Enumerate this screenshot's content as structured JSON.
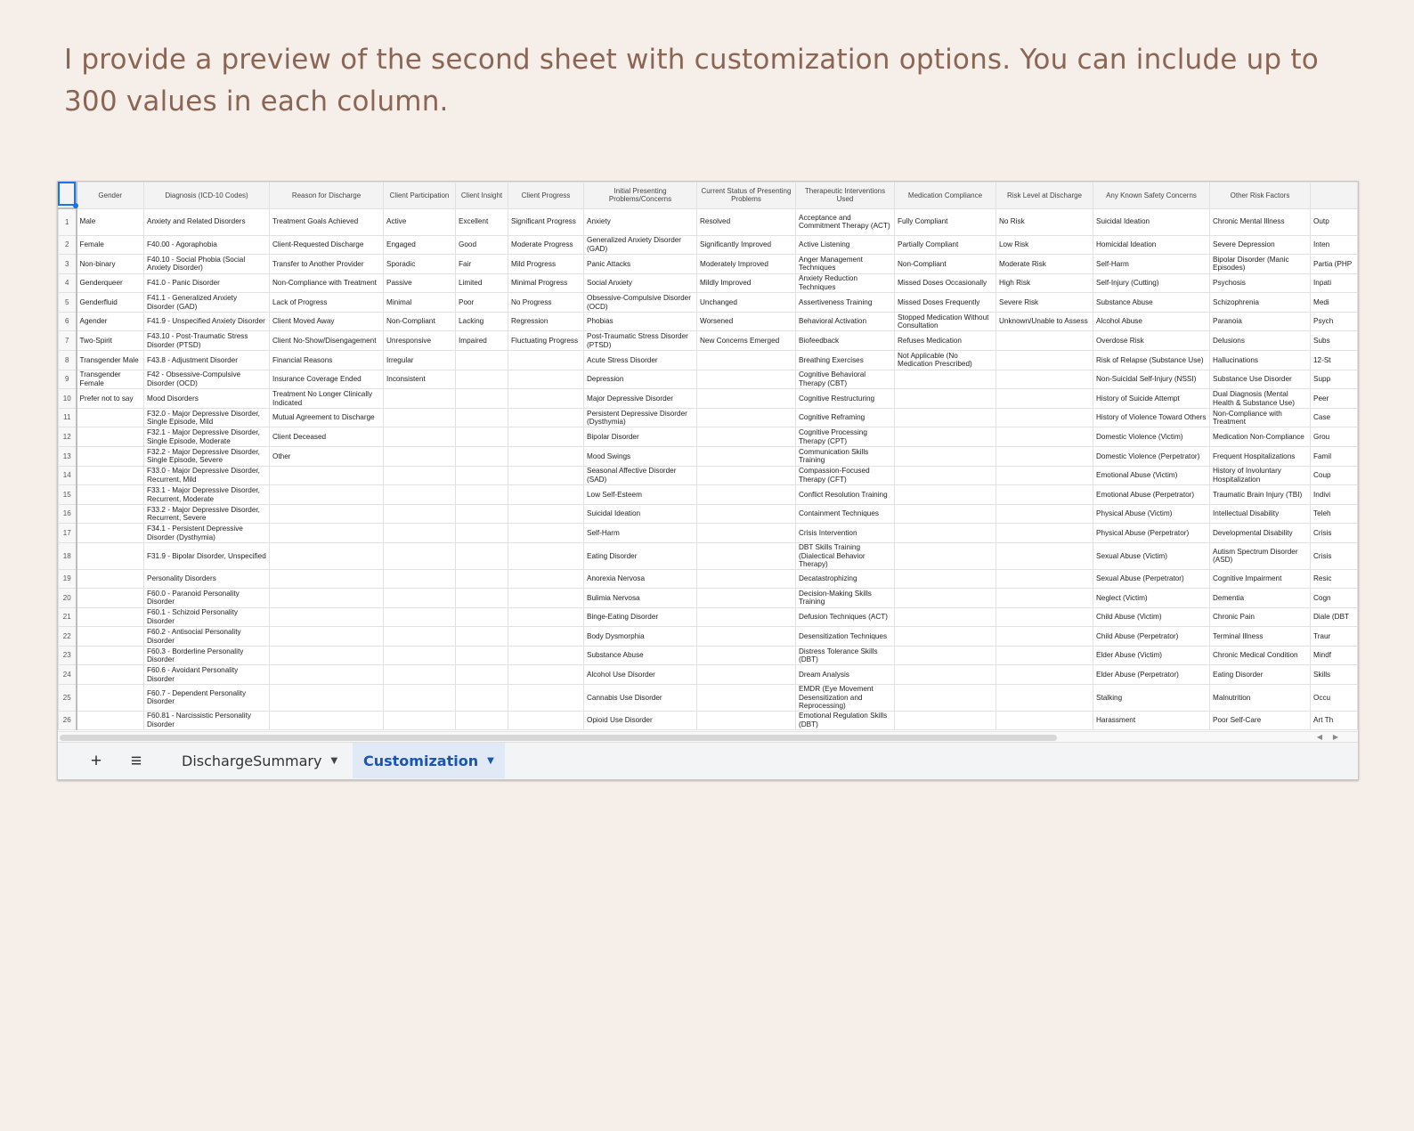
{
  "intro_text": "I provide a preview of the second sheet with customization options. You can include up to 300 values in each column.",
  "columns": [
    "Gender",
    "Diagnosis (ICD-10 Codes)",
    "Reason for Discharge",
    "Client Participation",
    "Client Insight",
    "Client Progress",
    "Initial Presenting Problems/Concerns",
    "Current Status of Presenting Problems",
    "Therapeutic Interventions Used",
    "Medication Compliance",
    "Risk Level at Discharge",
    "Any Known Safety Concerns",
    "Other Risk Factors",
    ""
  ],
  "rows": [
    [
      "1",
      "Male",
      "Anxiety and Related Disorders",
      "Treatment Goals Achieved",
      "Active",
      "Excellent",
      "Significant Progress",
      "Anxiety",
      "Resolved",
      "Acceptance and Commitment Therapy (ACT)",
      "Fully Compliant",
      "No Risk",
      "Suicidal Ideation",
      "Chronic Mental Illness",
      "Outp"
    ],
    [
      "2",
      "Female",
      "F40.00 - Agoraphobia",
      "Client-Requested Discharge",
      "Engaged",
      "Good",
      "Moderate Progress",
      "Generalized Anxiety Disorder (GAD)",
      "Significantly Improved",
      "Active Listening",
      "Partially Compliant",
      "Low Risk",
      "Homicidal Ideation",
      "Severe Depression",
      "Inten"
    ],
    [
      "3",
      "Non-binary",
      "F40.10 - Social Phobia (Social Anxiety Disorder)",
      "Transfer to Another Provider",
      "Sporadic",
      "Fair",
      "Mild Progress",
      "Panic Attacks",
      "Moderately Improved",
      "Anger Management Techniques",
      "Non-Compliant",
      "Moderate Risk",
      "Self-Harm",
      "Bipolar Disorder (Manic Episodes)",
      "Partia (PHP"
    ],
    [
      "4",
      "Genderqueer",
      "F41.0 - Panic Disorder",
      "Non-Compliance with Treatment",
      "Passive",
      "Limited",
      "Minimal Progress",
      "Social Anxiety",
      "Mildly Improved",
      "Anxiety Reduction Techniques",
      "Missed Doses Occasionally",
      "High Risk",
      "Self-Injury (Cutting)",
      "Psychosis",
      "Inpati"
    ],
    [
      "5",
      "Genderfluid",
      "F41.1 - Generalized Anxiety Disorder (GAD)",
      "Lack of Progress",
      "Minimal",
      "Poor",
      "No Progress",
      "Obsessive-Compulsive Disorder (OCD)",
      "Unchanged",
      "Assertiveness Training",
      "Missed Doses Frequently",
      "Severe Risk",
      "Substance Abuse",
      "Schizophrenia",
      "Medi"
    ],
    [
      "6",
      "Agender",
      "F41.9 - Unspecified Anxiety Disorder",
      "Client Moved Away",
      "Non-Compliant",
      "Lacking",
      "Regression",
      "Phobias",
      "Worsened",
      "Behavioral Activation",
      "Stopped Medication Without Consultation",
      "Unknown/Unable to Assess",
      "Alcohol Abuse",
      "Paranoia",
      "Psych"
    ],
    [
      "7",
      "Two-Spirit",
      "F43.10 - Post-Traumatic Stress Disorder (PTSD)",
      "Client No-Show/Disengagement",
      "Unresponsive",
      "Impaired",
      "Fluctuating Progress",
      "Post-Traumatic Stress Disorder (PTSD)",
      "New Concerns Emerged",
      "Biofeedback",
      "Refuses Medication",
      "",
      "Overdose Risk",
      "Delusions",
      "Subs"
    ],
    [
      "8",
      "Transgender Male",
      "F43.8 - Adjustment Disorder",
      "Financial Reasons",
      "Irregular",
      "",
      "",
      "Acute Stress Disorder",
      "",
      "Breathing Exercises",
      "Not Applicable (No Medication Prescribed)",
      "",
      "Risk of Relapse (Substance Use)",
      "Hallucinations",
      "12-St"
    ],
    [
      "9",
      "Transgender Female",
      "F42 - Obsessive-Compulsive Disorder (OCD)",
      "Insurance Coverage Ended",
      "Inconsistent",
      "",
      "",
      "Depression",
      "",
      "Cognitive Behavioral Therapy (CBT)",
      "",
      "",
      "Non-Suicidal Self-Injury (NSSI)",
      "Substance Use Disorder",
      "Supp"
    ],
    [
      "10",
      "Prefer not to say",
      "Mood Disorders",
      "Treatment No Longer Clinically Indicated",
      "",
      "",
      "",
      "Major Depressive Disorder",
      "",
      "Cognitive Restructuring",
      "",
      "",
      "History of Suicide Attempt",
      "Dual Diagnosis (Mental Health & Substance Use)",
      "Peer"
    ],
    [
      "11",
      "",
      "F32.0 - Major Depressive Disorder, Single Episode, Mild",
      "Mutual Agreement to Discharge",
      "",
      "",
      "",
      "Persistent Depressive Disorder (Dysthymia)",
      "",
      "Cognitive Reframing",
      "",
      "",
      "History of Violence Toward Others",
      "Non-Compliance with Treatment",
      "Case"
    ],
    [
      "12",
      "",
      "F32.1 - Major Depressive Disorder, Single Episode, Moderate",
      "Client Deceased",
      "",
      "",
      "",
      "Bipolar Disorder",
      "",
      "Cognitive Processing Therapy (CPT)",
      "",
      "",
      "Domestic Violence (Victim)",
      "Medication Non-Compliance",
      "Grou"
    ],
    [
      "13",
      "",
      "F32.2 - Major Depressive Disorder, Single Episode, Severe",
      "Other",
      "",
      "",
      "",
      "Mood Swings",
      "",
      "Communication Skills Training",
      "",
      "",
      "Domestic Violence (Perpetrator)",
      "Frequent Hospitalizations",
      "Famil"
    ],
    [
      "14",
      "",
      "F33.0 - Major Depressive Disorder, Recurrent, Mild",
      "",
      "",
      "",
      "",
      "Seasonal Affective Disorder (SAD)",
      "",
      "Compassion-Focused Therapy (CFT)",
      "",
      "",
      "Emotional Abuse (Victim)",
      "History of Involuntary Hospitalization",
      "Coup"
    ],
    [
      "15",
      "",
      "F33.1 - Major Depressive Disorder, Recurrent, Moderate",
      "",
      "",
      "",
      "",
      "Low Self-Esteem",
      "",
      "Conflict Resolution Training",
      "",
      "",
      "Emotional Abuse (Perpetrator)",
      "Traumatic Brain Injury (TBI)",
      "Indivi"
    ],
    [
      "16",
      "",
      "F33.2 - Major Depressive Disorder, Recurrent, Severe",
      "",
      "",
      "",
      "",
      "Suicidal Ideation",
      "",
      "Containment Techniques",
      "",
      "",
      "Physical Abuse (Victim)",
      "Intellectual Disability",
      "Teleh"
    ],
    [
      "17",
      "",
      "F34.1 - Persistent Depressive Disorder (Dysthymia)",
      "",
      "",
      "",
      "",
      "Self-Harm",
      "",
      "Crisis Intervention",
      "",
      "",
      "Physical Abuse (Perpetrator)",
      "Developmental Disability",
      "Crisis"
    ],
    [
      "18",
      "",
      "F31.9 - Bipolar Disorder, Unspecified",
      "",
      "",
      "",
      "",
      "Eating Disorder",
      "",
      "DBT Skills Training (Dialectical Behavior Therapy)",
      "",
      "",
      "Sexual Abuse (Victim)",
      "Autism Spectrum Disorder (ASD)",
      "Crisis"
    ],
    [
      "19",
      "",
      "Personality Disorders",
      "",
      "",
      "",
      "",
      "Anorexia Nervosa",
      "",
      "Decatastrophizing",
      "",
      "",
      "Sexual Abuse (Perpetrator)",
      "Cognitive Impairment",
      "Resic"
    ],
    [
      "20",
      "",
      "F60.0 - Paranoid Personality Disorder",
      "",
      "",
      "",
      "",
      "Bulimia Nervosa",
      "",
      "Decision-Making Skills Training",
      "",
      "",
      "Neglect (Victim)",
      "Dementia",
      "Cogn"
    ],
    [
      "21",
      "",
      "F60.1 - Schizoid Personality Disorder",
      "",
      "",
      "",
      "",
      "Binge-Eating Disorder",
      "",
      "Defusion Techniques (ACT)",
      "",
      "",
      "Child Abuse (Victim)",
      "Chronic Pain",
      "Diale (DBT"
    ],
    [
      "22",
      "",
      "F60.2 - Antisocial Personality Disorder",
      "",
      "",
      "",
      "",
      "Body Dysmorphia",
      "",
      "Desensitization Techniques",
      "",
      "",
      "Child Abuse (Perpetrator)",
      "Terminal Illness",
      "Traur"
    ],
    [
      "23",
      "",
      "F60.3 - Borderline Personality Disorder",
      "",
      "",
      "",
      "",
      "Substance Abuse",
      "",
      "Distress Tolerance Skills (DBT)",
      "",
      "",
      "Elder Abuse (Victim)",
      "Chronic Medical Condition",
      "Mindf"
    ],
    [
      "24",
      "",
      "F60.6 - Avoidant Personality Disorder",
      "",
      "",
      "",
      "",
      "Alcohol Use Disorder",
      "",
      "Dream Analysis",
      "",
      "",
      "Elder Abuse (Perpetrator)",
      "Eating Disorder",
      "Skills"
    ],
    [
      "25",
      "",
      "F60.7 - Dependent Personality Disorder",
      "",
      "",
      "",
      "",
      "Cannabis Use Disorder",
      "",
      "EMDR (Eye Movement Desensitization and Reprocessing)",
      "",
      "",
      "Stalking",
      "Malnutrition",
      "Occu"
    ],
    [
      "26",
      "",
      "F60.81 - Narcissistic Personality Disorder",
      "",
      "",
      "",
      "",
      "Opioid Use Disorder",
      "",
      "Emotional Regulation Skills (DBT)",
      "",
      "",
      "Harassment",
      "Poor Self-Care",
      "Art Th"
    ]
  ],
  "tabs": {
    "add_icon": "plus-icon",
    "menu_icon": "menu-icon",
    "sheet1": "DischargeSummary",
    "sheet2": "Customization"
  },
  "accent_color": "#1a73e8"
}
